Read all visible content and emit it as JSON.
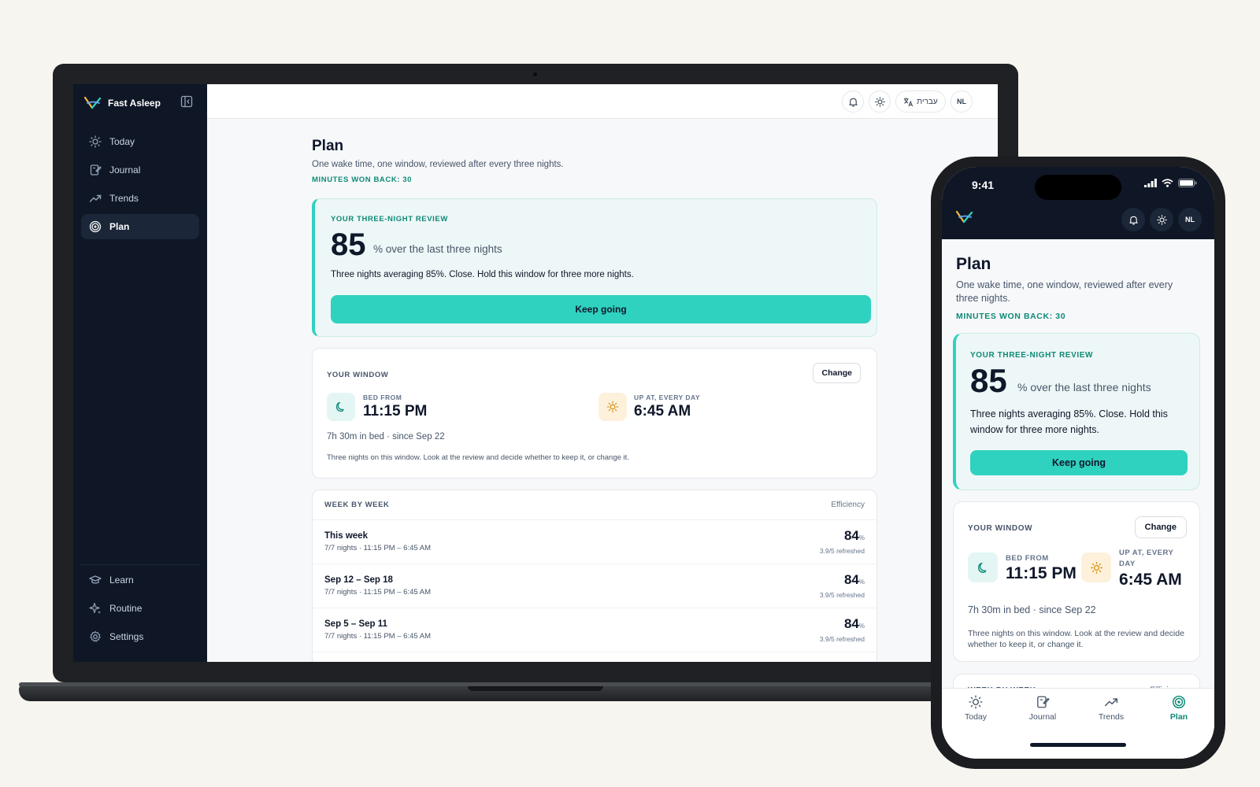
{
  "app": {
    "name": "Fast Asleep",
    "user_initials": "NL",
    "language_label": "עברית"
  },
  "sidebar": {
    "items": [
      {
        "label": "Today",
        "icon": "sun-icon"
      },
      {
        "label": "Journal",
        "icon": "journal-icon"
      },
      {
        "label": "Trends",
        "icon": "trend-icon"
      },
      {
        "label": "Plan",
        "icon": "target-icon",
        "active": true
      }
    ],
    "bottom_items": [
      {
        "label": "Learn",
        "icon": "graduation-cap-icon"
      },
      {
        "label": "Routine",
        "icon": "sparkle-icon"
      },
      {
        "label": "Settings",
        "icon": "gear-icon"
      }
    ]
  },
  "page": {
    "title": "Plan",
    "subtitle": "One wake time, one window, reviewed after every three nights.",
    "minutes_won_back": "MINUTES WON BACK: 30"
  },
  "review": {
    "label": "YOUR THREE-NIGHT REVIEW",
    "score": "85",
    "score_unit": "% over the last three nights",
    "message": "Three nights averaging 85%. Close. Hold this window for three more nights.",
    "button": "Keep going"
  },
  "window": {
    "label": "YOUR WINDOW",
    "change_button": "Change",
    "bed_label": "BED FROM",
    "bed_time": "11:15 PM",
    "wake_label": "UP AT, EVERY DAY",
    "wake_label_phone_line1": "UP AT, EVERY",
    "wake_label_phone_line2": "DAY",
    "wake_time": "6:45 AM",
    "meta": "7h 30m in bed · since Sep 22",
    "note": "Three nights on this window. Look at the review and decide whether to keep it, or change it."
  },
  "weeks": {
    "label": "WEEK BY WEEK",
    "column": "Efficiency",
    "rows": [
      {
        "name": "This week",
        "detail": "7/7 nights · 11:15 PM – 6:45 AM",
        "value": "84",
        "unit": "%",
        "refreshed": "3.9/5 refreshed"
      },
      {
        "name": "Sep 12 – Sep 18",
        "detail": "7/7 nights · 11:15 PM – 6:45 AM",
        "value": "84",
        "unit": "%",
        "refreshed": "3.9/5 refreshed"
      },
      {
        "name": "Sep 5 – Sep 11",
        "detail": "7/7 nights · 11:15 PM – 6:45 AM",
        "value": "84",
        "unit": "%",
        "refreshed": "3.9/5 refreshed"
      }
    ]
  },
  "phone": {
    "status_time": "9:41",
    "tabs": [
      {
        "label": "Today",
        "icon": "sun-icon"
      },
      {
        "label": "Journal",
        "icon": "journal-icon"
      },
      {
        "label": "Trends",
        "icon": "trend-icon"
      },
      {
        "label": "Plan",
        "icon": "target-icon",
        "active": true
      }
    ]
  },
  "colors": {
    "accent": "#2fd2bf",
    "accent_text": "#0d8a76",
    "sidebar_bg": "#0f1726",
    "background": "#f6f5f0"
  }
}
